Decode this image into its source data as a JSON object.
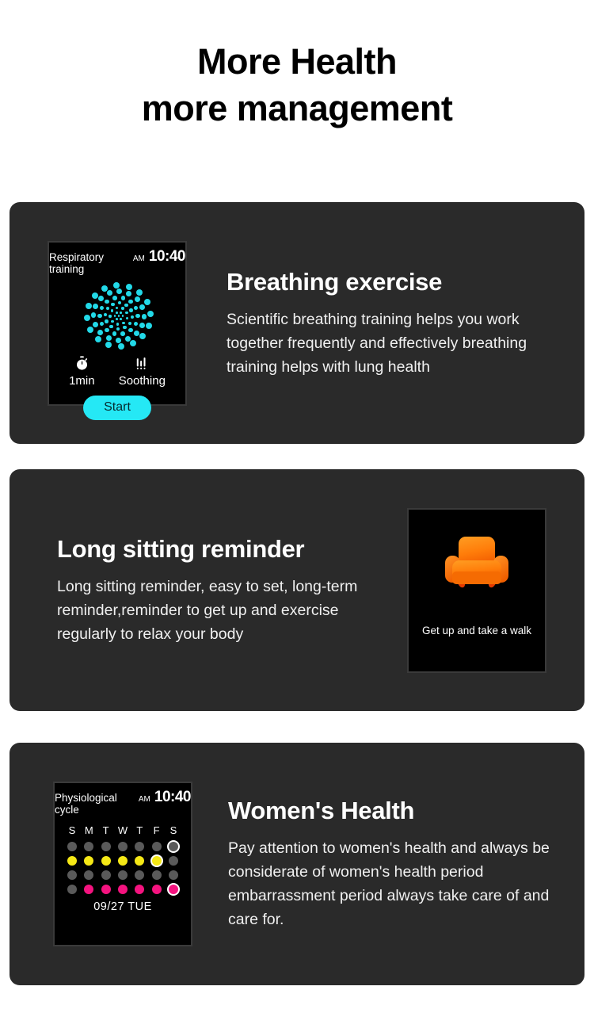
{
  "heading": {
    "line1": "More Health",
    "line2": "more management"
  },
  "cards": [
    {
      "id": "breathing",
      "title": "Breathing exercise",
      "description": "Scientific breathing training helps you work together frequently and effectively breathing training helps with lung health",
      "watch": {
        "screen_title": "Respiratory training",
        "meridiem": "AM",
        "time": "10:40",
        "duration_label": "1min",
        "duration_icon": "stopwatch-icon",
        "mode_label": "Soothing",
        "mode_icon": "equalizer-bars-icon",
        "start_button": "Start",
        "dot_color": "#22d9e8",
        "button_color": "#25e8f5"
      }
    },
    {
      "id": "sitting",
      "title": "Long sitting reminder",
      "description": "Long sitting reminder, easy to set, long-term reminder,reminder to get up and exercise regularly to relax your body",
      "panel": {
        "icon": "armchair-sofa-icon",
        "icon_color": "#ff7a00",
        "caption": "Get up and take a walk"
      }
    },
    {
      "id": "women",
      "title": "Women's Health",
      "description": "Pay attention to women's health and always be considerate of women's health period embarrassment period always take care of and care for.",
      "watch": {
        "screen_title": "Physiological cycle",
        "meridiem": "AM",
        "time": "10:40",
        "weekdays": [
          "S",
          "M",
          "T",
          "W",
          "T",
          "F",
          "S"
        ],
        "date": "09/27   TUE",
        "colors": {
          "gray": "#5a5a5a",
          "yellow": "#f5e816",
          "pink": "#f4137f"
        },
        "dot_rows": [
          [
            "gray",
            "gray",
            "gray",
            "gray",
            "gray",
            "gray",
            "gray ring"
          ],
          [
            "yellow",
            "yellow",
            "yellow",
            "yellow",
            "yellow",
            "yellow ring",
            "gray"
          ],
          [
            "gray",
            "gray",
            "gray",
            "gray",
            "gray",
            "gray",
            "gray"
          ],
          [
            "gray",
            "pink",
            "pink",
            "pink",
            "pink",
            "pink",
            "pink ring"
          ]
        ]
      }
    }
  ],
  "theme": {
    "page_background": "#ffffff",
    "card_background": "#2a2a2a",
    "screen_background": "#000000",
    "text_primary": "#ffffff"
  }
}
